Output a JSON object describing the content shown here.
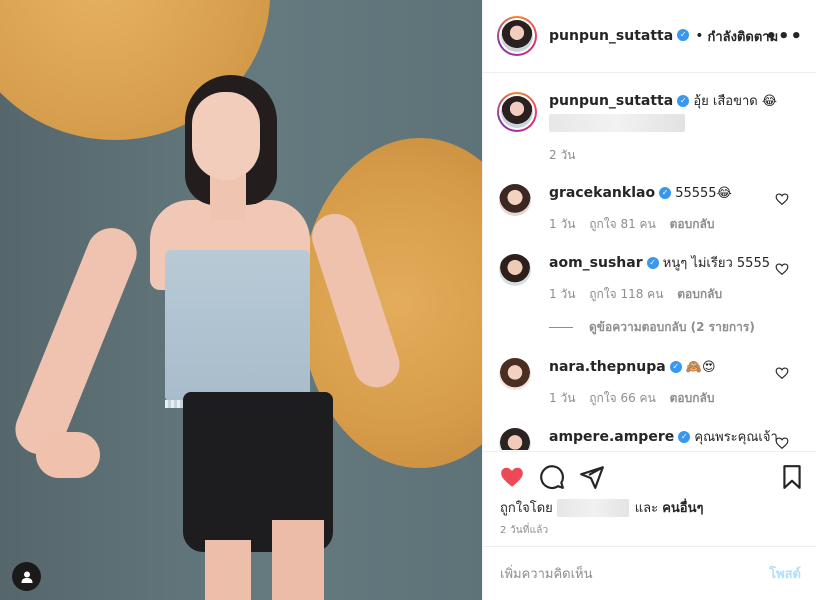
{
  "post": {
    "author": "punpun_sutatta",
    "follow_status": "กำลังติดตาม",
    "more_icon": "more-horizontal-icon",
    "caption_text": "อุ้ย เสือขาด 😂",
    "caption_time": "2 วัน"
  },
  "comments": [
    {
      "username": "gracekanklao",
      "text": "55555😂",
      "time": "1 วัน",
      "likes": "ถูกใจ 81 คน",
      "reply": "ตอบกลับ"
    },
    {
      "username": "aom_sushar",
      "text": "หนูๆ ไม่เรียว 5555",
      "time": "1 วัน",
      "likes": "ถูกใจ 118 คน",
      "reply": "ตอบกลับ"
    },
    {
      "username": "nara.thepnupa",
      "text": "🙈😍",
      "time": "1 วัน",
      "likes": "ถูกใจ 66 คน",
      "reply": "ตอบกลับ"
    },
    {
      "username": "ampere.ampere",
      "text": "คุณพระคุณเจ้า"
    }
  ],
  "view_replies": "ดูข้อความตอบกลับ (2 รายการ)",
  "likes": {
    "prefix": "ถูกใจโดย",
    "middle": "และ",
    "others": "คนอื่นๆ"
  },
  "post_time": "2 วันที่แล้ว",
  "add_comment": {
    "placeholder": "เพิ่มความคิดเห็น",
    "post_label": "โพสต์"
  },
  "colors": {
    "like_red": "#ed4956",
    "verified_blue": "#3897f0",
    "post_disabled": "#b2dffc"
  }
}
